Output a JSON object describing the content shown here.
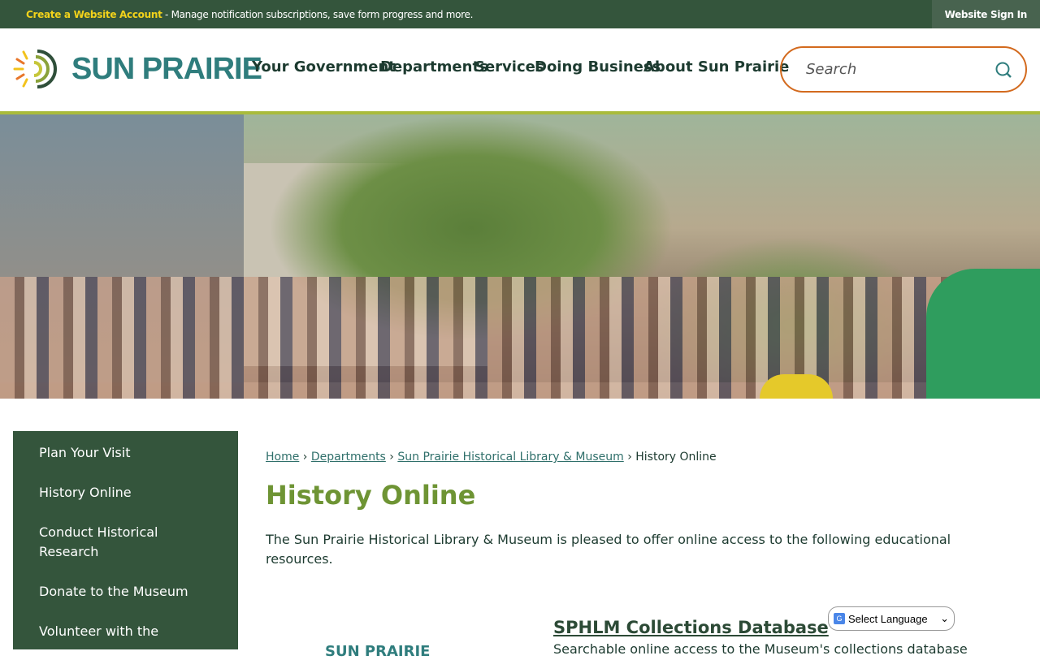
{
  "topbar": {
    "create_link": "Create a Website Account",
    "message": " - Manage notification subscriptions, save form progress and more.",
    "sign_in": "Website Sign In"
  },
  "logo": {
    "name": "SUN PRAIRIE"
  },
  "nav": [
    "Your Government",
    "Departments",
    "Services",
    "Doing Business",
    "About Sun Prairie"
  ],
  "search": {
    "placeholder": "Search"
  },
  "sidebar": [
    "Plan Your Visit",
    "History Online",
    "Conduct Historical Research",
    "Donate to the Museum",
    "Volunteer with the"
  ],
  "breadcrumb": {
    "home": "Home",
    "departments": "Departments",
    "museum": "Sun Prairie Historical Library & Museum",
    "current": "History Online"
  },
  "page": {
    "title": "History Online",
    "intro": "The Sun Prairie Historical Library & Museum is pleased to offer online access to the following educational resources."
  },
  "db": {
    "title": "SPHLM Collections Database",
    "desc": "Searchable online access to the Museum's collections database",
    "thumb_text": "SUN PRAIRIE"
  },
  "language": {
    "selected": "Select Language"
  },
  "colors": {
    "dark_green": "#34553c",
    "accent_yellow": "#f2d21b",
    "teal": "#2f7d7d",
    "olive": "#6e9434",
    "search_border": "#d36a1e"
  }
}
